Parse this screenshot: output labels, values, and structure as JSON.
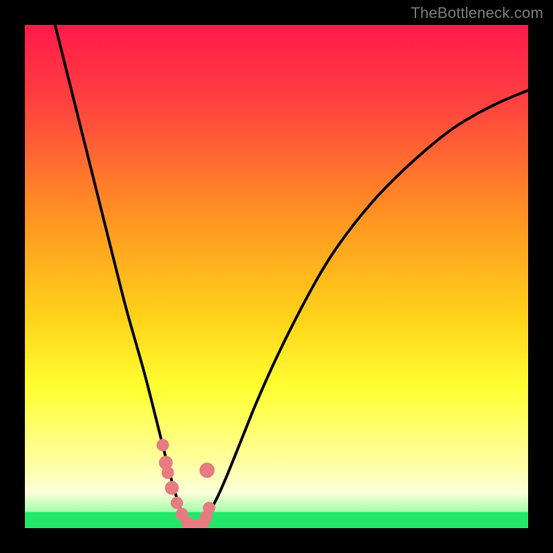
{
  "watermark": "TheBottleneck.com",
  "colors": {
    "frame": "#000000",
    "curve": "#000000",
    "marker_fill": "#e77b82",
    "optimal_band": "#23e86a",
    "gradient_stops": [
      {
        "offset": 0.0,
        "color": "#ff1a4b"
      },
      {
        "offset": 0.15,
        "color": "#ff4040"
      },
      {
        "offset": 0.4,
        "color": "#ff9a20"
      },
      {
        "offset": 0.58,
        "color": "#ffd21a"
      },
      {
        "offset": 0.72,
        "color": "#ffff30"
      },
      {
        "offset": 0.86,
        "color": "#ffff9a"
      },
      {
        "offset": 0.93,
        "color": "#fbffd8"
      },
      {
        "offset": 0.965,
        "color": "#a8ffb0"
      },
      {
        "offset": 1.0,
        "color": "#23e86a"
      }
    ]
  },
  "chart_data": {
    "type": "line",
    "title": "",
    "xlabel": "",
    "ylabel": "",
    "xlim": [
      0,
      100
    ],
    "ylim": [
      0,
      100
    ],
    "series": [
      {
        "name": "bottleneck-curve",
        "x": [
          6,
          8,
          10,
          12,
          14,
          16,
          18,
          20,
          22,
          24,
          26,
          27,
          28,
          29,
          30,
          31,
          32,
          33,
          34,
          35,
          36,
          38,
          40,
          42,
          44,
          46,
          50,
          55,
          60,
          65,
          70,
          75,
          80,
          85,
          90,
          95,
          100
        ],
        "y": [
          100,
          92,
          84,
          76,
          68,
          60,
          52,
          44,
          37,
          30,
          22,
          18,
          14,
          10,
          6.5,
          3.5,
          1.5,
          0.5,
          0.5,
          1.0,
          2.0,
          5.5,
          10,
          15,
          20,
          25,
          34,
          44,
          53,
          60,
          66,
          71,
          75.5,
          79.5,
          82.5,
          85,
          87
        ]
      }
    ],
    "markers": {
      "name": "highlighted-points",
      "x": [
        27.4,
        28.0,
        28.4,
        29.2,
        30.2,
        31.2,
        32.2,
        33.0,
        34.2,
        35.4,
        36.0,
        36.6,
        36.2
      ],
      "y": [
        16.5,
        13.0,
        11.0,
        8.0,
        5.0,
        2.8,
        1.2,
        0.6,
        0.6,
        0.9,
        2.2,
        4.0,
        11.5
      ],
      "r": [
        9,
        10,
        9,
        10,
        9,
        9,
        9,
        9,
        9,
        9,
        9,
        9,
        11
      ]
    },
    "optimal_band": {
      "y_from": 0,
      "y_to": 3.2
    }
  }
}
